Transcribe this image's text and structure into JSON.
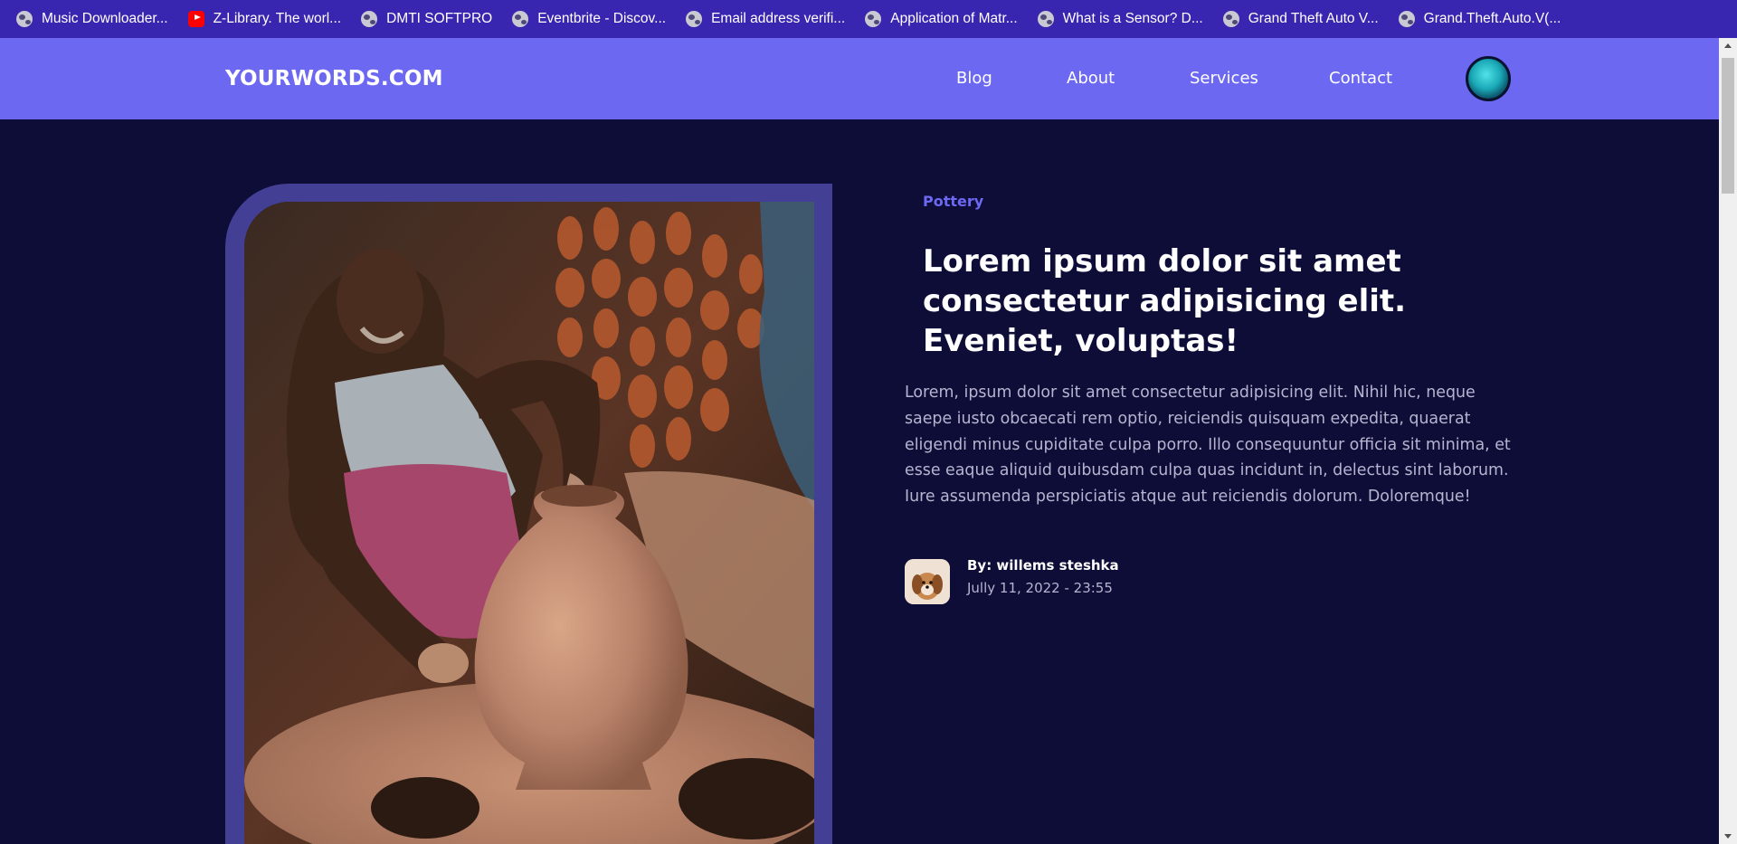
{
  "bookmarks": [
    {
      "label": "Music Downloader...",
      "icon": "globe-icon"
    },
    {
      "label": "Z-Library. The worl...",
      "icon": "youtube-icon"
    },
    {
      "label": "DMTI SOFTPRO",
      "icon": "globe-icon"
    },
    {
      "label": "Eventbrite - Discov...",
      "icon": "globe-icon"
    },
    {
      "label": "Email address verifi...",
      "icon": "globe-icon"
    },
    {
      "label": "Application of Matr...",
      "icon": "globe-icon"
    },
    {
      "label": "What is a Sensor? D...",
      "icon": "globe-icon"
    },
    {
      "label": "Grand Theft Auto V...",
      "icon": "globe-icon"
    },
    {
      "label": "Grand.Theft.Auto.V(...",
      "icon": "globe-icon"
    }
  ],
  "header": {
    "logo": "YOURWORDS.COM",
    "nav": {
      "blog": "Blog",
      "about": "About",
      "services": "Services",
      "contact": "Contact"
    }
  },
  "post": {
    "category": "Pottery",
    "title": "Lorem ipsum dolor sit amet consectetur adipisicing elit. Eveniet, voluptas!",
    "body": "Lorem, ipsum dolor sit amet consectetur adipisicing elit. Nihil hic, neque saepe iusto obcaecati rem optio, reiciendis quisquam expedita, quaerat eligendi minus cupiditate culpa porro. Illo consequuntur officia sit minima, et esse eaque aliquid quibusdam culpa quas incidunt in, delectus sint laborum. Iure assumenda perspiciatis atque aut reiciendis dolorum. Doloremque!",
    "author": "By: willems steshka",
    "date": "Jully 11, 2022 - 23:55"
  },
  "colors": {
    "bookmarks_bg": "#3826b0",
    "header_bg": "#6d68f2",
    "page_bg": "#0e0d38",
    "frame": "#433f94",
    "accent": "#6d68f2"
  }
}
